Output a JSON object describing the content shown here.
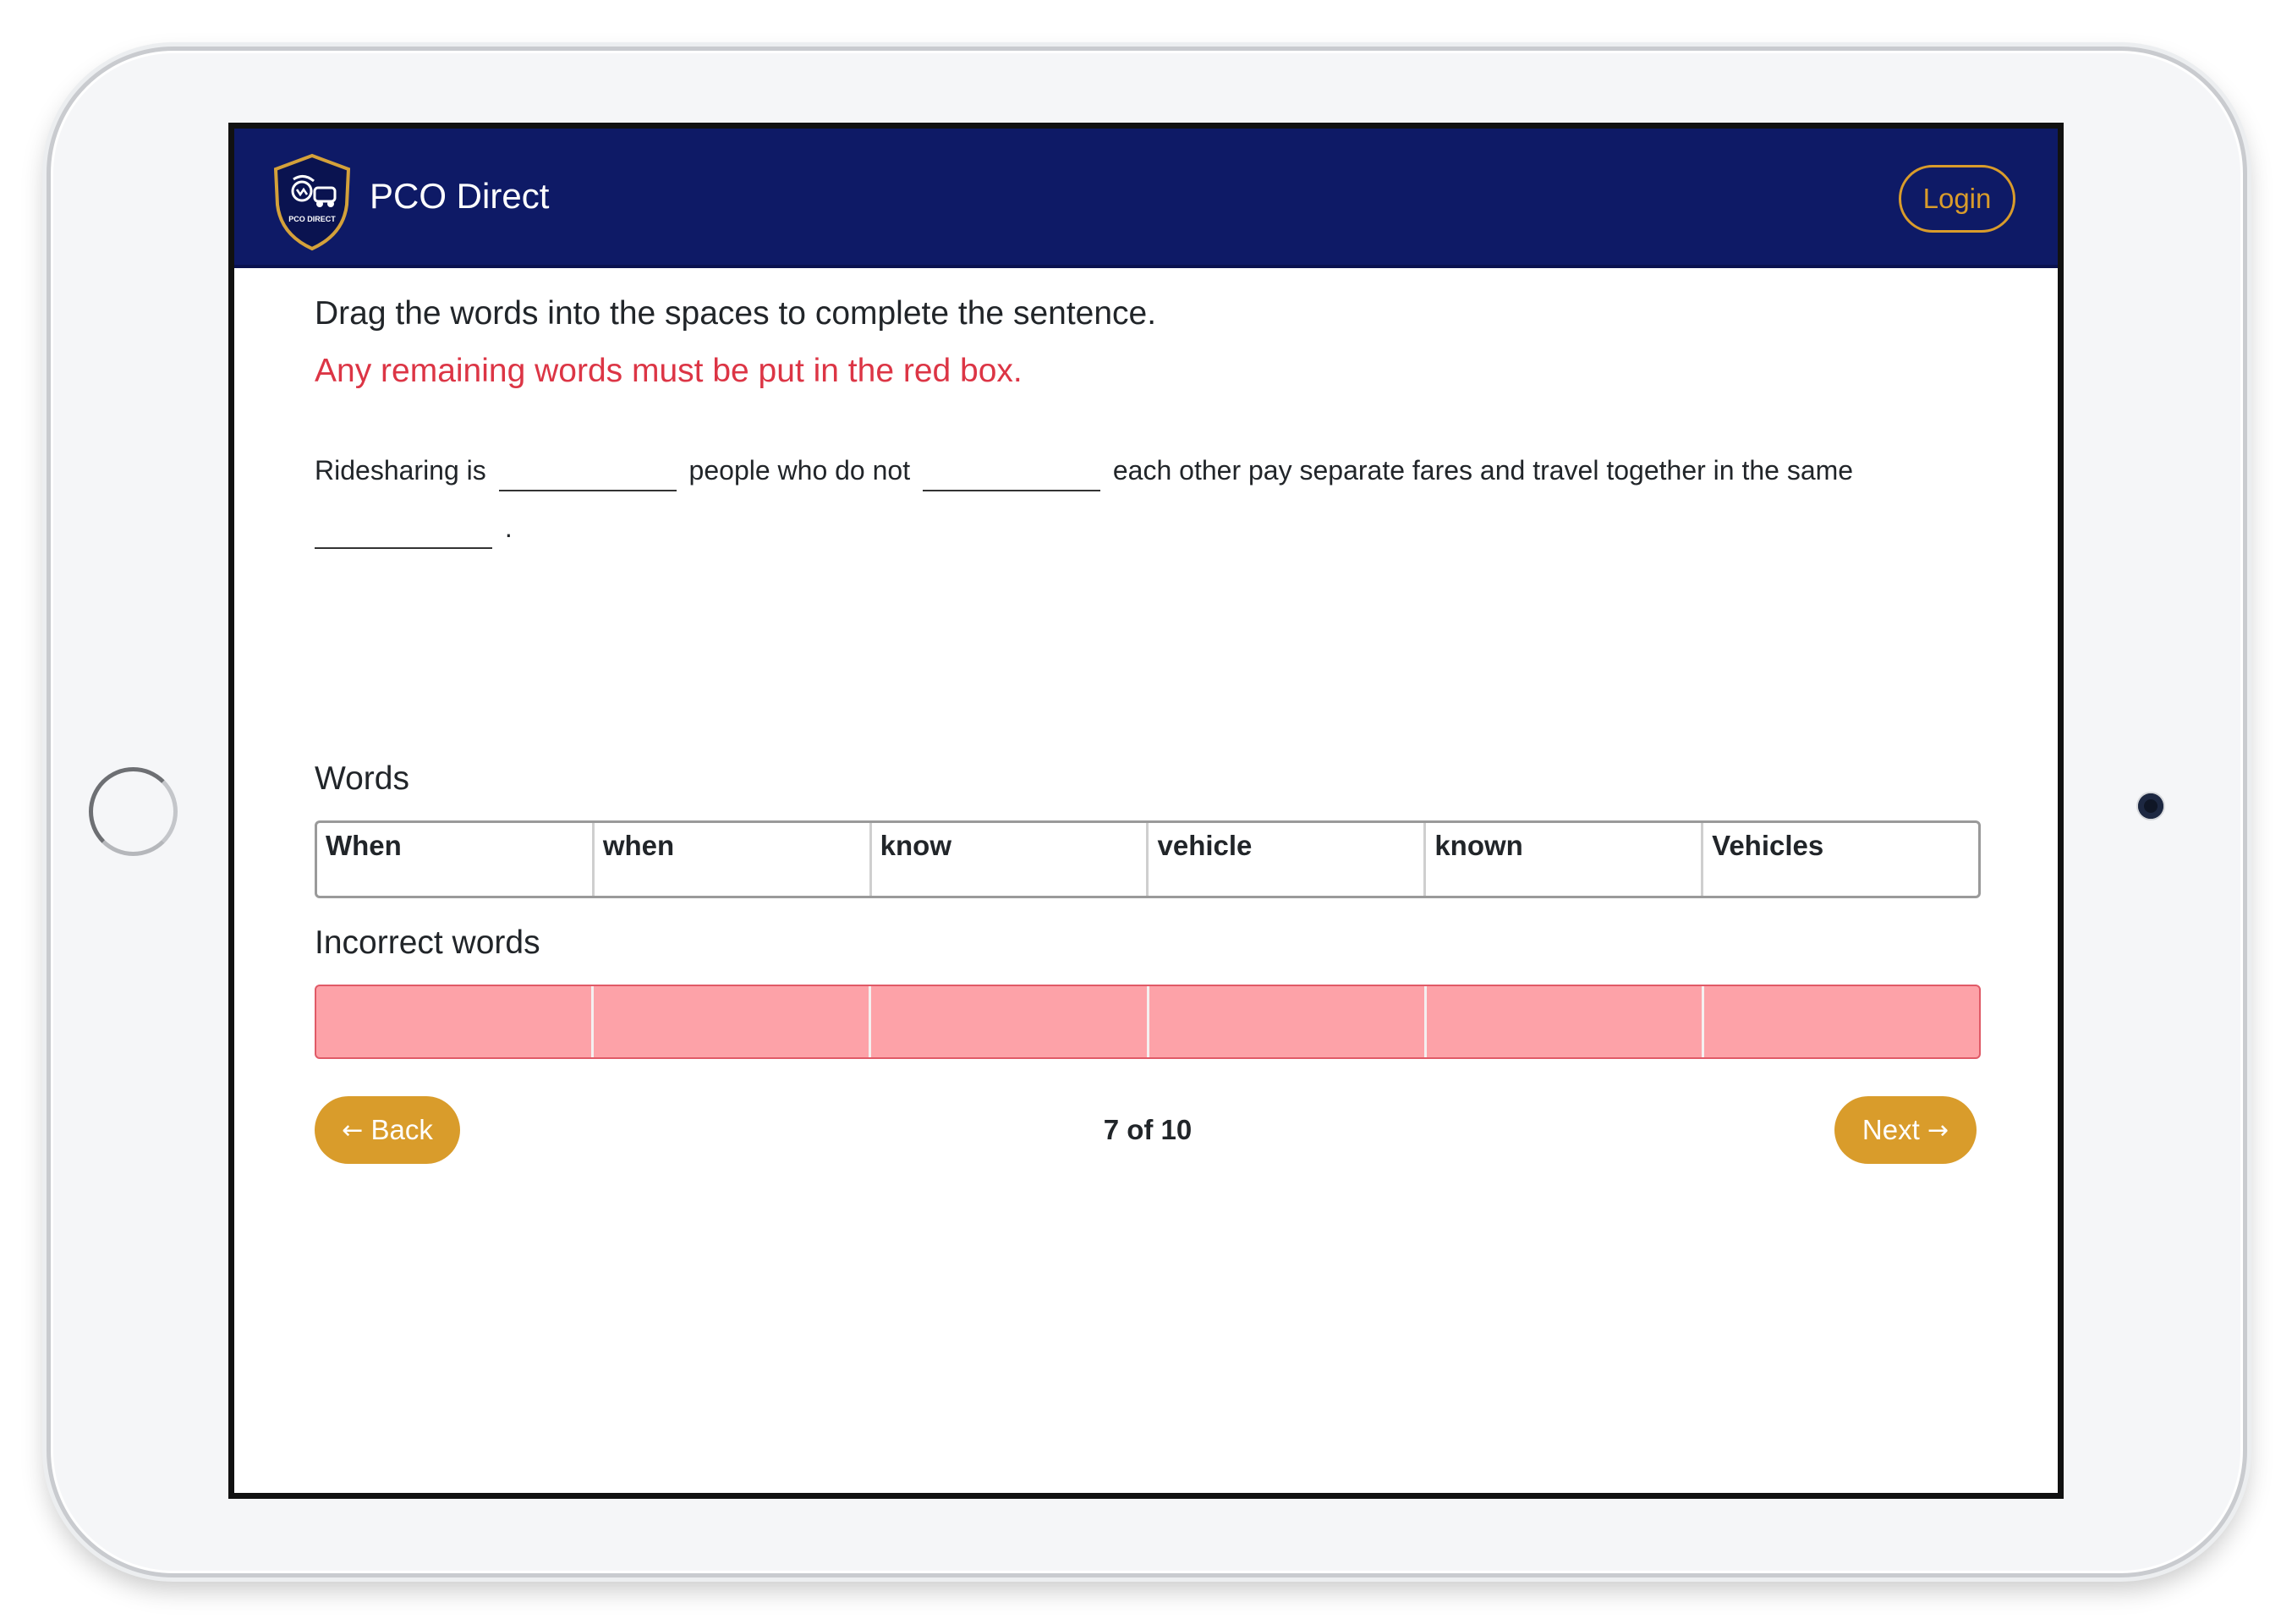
{
  "navbar": {
    "brand": "PCO Direct",
    "logo_text": "PCO DIRECT",
    "login_label": "Login"
  },
  "instructions": {
    "title": "Drag the words into the spaces to complete the sentence.",
    "warning": "Any remaining words must be put in the red box."
  },
  "sentence": {
    "part1": "Ridesharing is",
    "part2": "people who do not",
    "part3": "each other pay separate fares and travel together in the same",
    "part4": "."
  },
  "words": {
    "label": "Words",
    "items": [
      "When",
      "when",
      "know",
      "vehicle",
      "known",
      "Vehicles"
    ]
  },
  "incorrect": {
    "label": "Incorrect words"
  },
  "navigation": {
    "back_arrow": "←",
    "back_label": "Back",
    "next_label": "Next",
    "next_arrow": "→",
    "progress": "7 of 10"
  },
  "colors": {
    "navbar": "#0e1a66",
    "accent": "#d99c2b",
    "warning": "#dc3545",
    "incorrect_box": "#fda2a8"
  }
}
